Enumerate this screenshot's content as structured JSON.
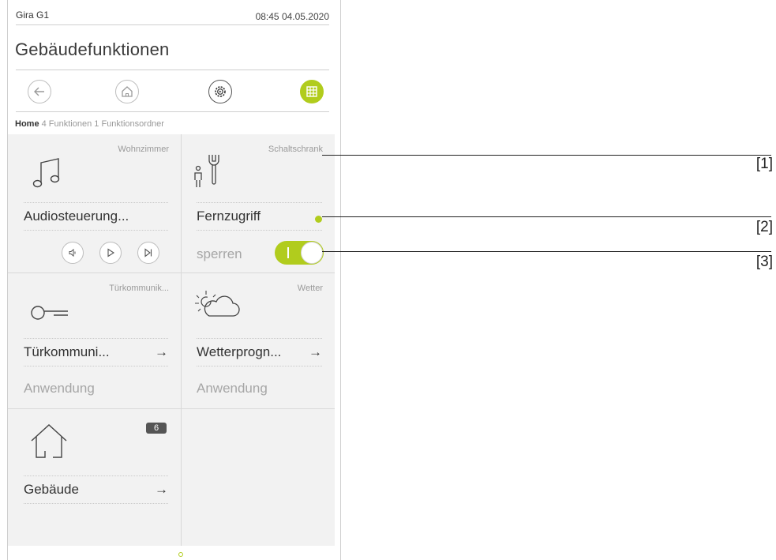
{
  "status": {
    "brand": "Gira G1",
    "time": "08:45 04.05.2020"
  },
  "page": {
    "title": "Gebäudefunktionen"
  },
  "nav": {
    "buttons": [
      {
        "icon": "back-arrow-icon"
      },
      {
        "icon": "home-icon"
      },
      {
        "icon": "settings-gear-icon"
      },
      {
        "icon": "grid-icon",
        "active": true
      }
    ]
  },
  "breadcrumb": {
    "home": "Home",
    "functions": "4 Funktionen",
    "folders": "1 Funktionsordner"
  },
  "tiles": {
    "audio": {
      "location": "Wohnzimmer",
      "name": "Audiosteuerung...",
      "icon": "music-note-icon"
    },
    "remote": {
      "location": "Schaltschrank",
      "name": "Fernzugriff",
      "sub": "sperren",
      "toggle_on": true,
      "icon": "service-tools-icon"
    },
    "door": {
      "location": "Türkommunik...",
      "name": "Türkommuni...",
      "arrow": "→",
      "sub": "Anwendung",
      "icon": "key-icon"
    },
    "weather": {
      "location": "Wetter",
      "name": "Wetterprogn...",
      "arrow": "→",
      "sub": "Anwendung",
      "icon": "sun-cloud-icon"
    },
    "building": {
      "badge": "6",
      "name": "Gebäude",
      "arrow": "→",
      "icon": "house-icon"
    }
  },
  "callouts": [
    "[1]",
    "[2]",
    "[3]"
  ],
  "colors": {
    "accent": "#b1cc1d",
    "tile_bg": "#f2f2f2",
    "divider": "#cfcfcf"
  }
}
